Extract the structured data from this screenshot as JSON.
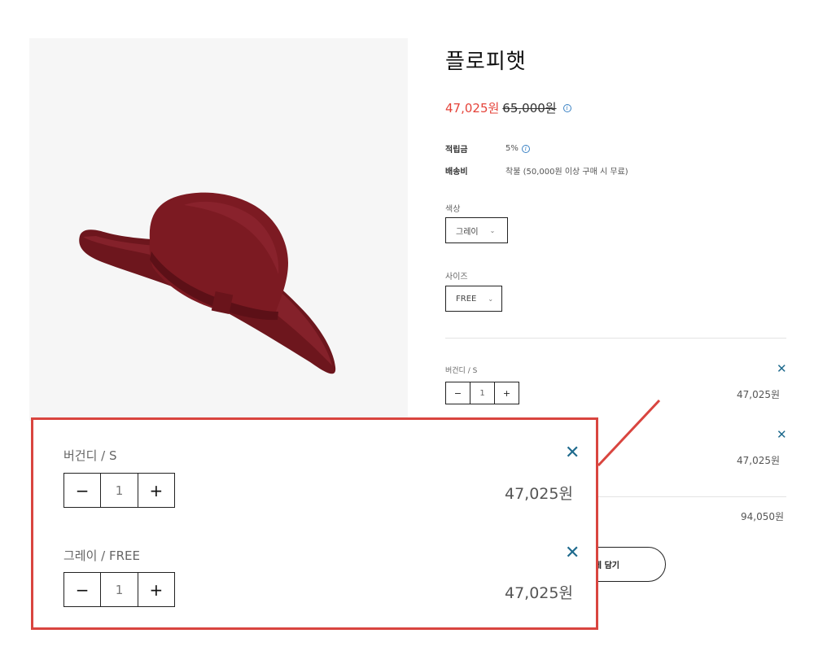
{
  "product": {
    "title": "플로피햇",
    "sale_price": "47,025원",
    "original_price": "65,000원",
    "points_label": "적립금",
    "points_value": "5%",
    "shipping_label": "배송비",
    "shipping_value": "착불 (50,000원 이상 구매 시 무료)",
    "image_icon": "floppy-hat-image",
    "hat_color": "#7c1a22"
  },
  "options": {
    "color_label": "색상",
    "color_selected": "그레이",
    "size_label": "사이즈",
    "size_selected": "FREE"
  },
  "selected_items": [
    {
      "name": "버건디 / S",
      "quantity": "1",
      "price": "47,025원"
    },
    {
      "name": "그레이 / FREE",
      "quantity": "1",
      "price": "47,025원"
    }
  ],
  "total_price": "94,050원",
  "cart_button_label": "구니에 담기",
  "icons": {
    "remove": "close-icon",
    "minus": "minus-icon",
    "plus": "plus-icon",
    "info": "info-icon",
    "chevron": "chevron-down-icon"
  },
  "colors": {
    "sale_price": "#e5433a",
    "remove_icon": "#1e6a8d",
    "callout_border": "#d9453f"
  }
}
